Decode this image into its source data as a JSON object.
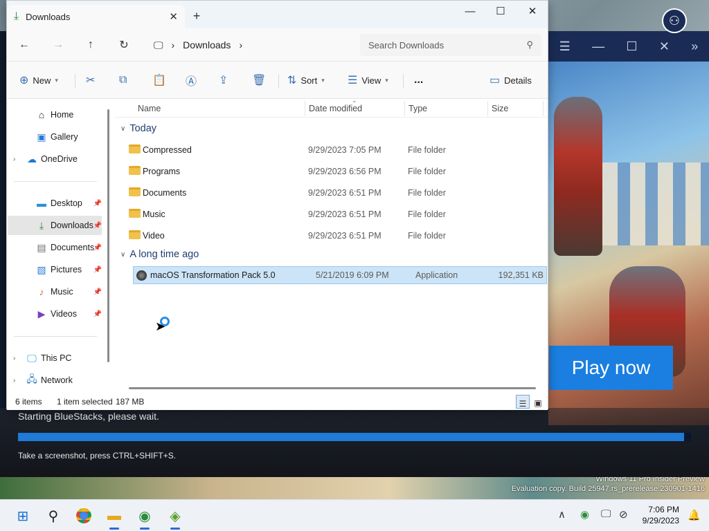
{
  "explorer": {
    "tab_title": "Downloads",
    "address": {
      "segment": "Downloads"
    },
    "search_placeholder": "Search Downloads",
    "toolbar": {
      "new_label": "New",
      "sort_label": "Sort",
      "view_label": "View",
      "more_label": "...",
      "details_label": "Details"
    },
    "sidebar": {
      "items": [
        {
          "label": "Home",
          "icon": "home-icon",
          "expandable": false,
          "pinned": false
        },
        {
          "label": "Gallery",
          "icon": "gallery-icon",
          "expandable": false,
          "pinned": false
        },
        {
          "label": "OneDrive",
          "icon": "cloud-icon",
          "expandable": true,
          "pinned": false
        },
        {
          "label": "Desktop",
          "icon": "desktop-icon",
          "expandable": false,
          "pinned": true
        },
        {
          "label": "Downloads",
          "icon": "download-icon",
          "expandable": false,
          "pinned": true,
          "selected": true
        },
        {
          "label": "Documents",
          "icon": "document-icon",
          "expandable": false,
          "pinned": true
        },
        {
          "label": "Pictures",
          "icon": "picture-icon",
          "expandable": false,
          "pinned": true
        },
        {
          "label": "Music",
          "icon": "music-icon",
          "expandable": false,
          "pinned": true
        },
        {
          "label": "Videos",
          "icon": "video-icon",
          "expandable": false,
          "pinned": true
        },
        {
          "label": "This PC",
          "icon": "monitor-icon",
          "expandable": true,
          "pinned": false
        },
        {
          "label": "Network",
          "icon": "network-icon",
          "expandable": true,
          "pinned": false
        }
      ]
    },
    "columns": {
      "name": "Name",
      "date": "Date modified",
      "type": "Type",
      "size": "Size"
    },
    "groups": [
      {
        "label": "Today",
        "files": [
          {
            "name": "Compressed",
            "date": "9/29/2023 7:05 PM",
            "type": "File folder",
            "size": "",
            "icon": "folder-icon"
          },
          {
            "name": "Programs",
            "date": "9/29/2023 6:56 PM",
            "type": "File folder",
            "size": "",
            "icon": "folder-icon"
          },
          {
            "name": "Documents",
            "date": "9/29/2023 6:51 PM",
            "type": "File folder",
            "size": "",
            "icon": "folder-icon"
          },
          {
            "name": "Music",
            "date": "9/29/2023 6:51 PM",
            "type": "File folder",
            "size": "",
            "icon": "folder-icon"
          },
          {
            "name": "Video",
            "date": "9/29/2023 6:51 PM",
            "type": "File folder",
            "size": "",
            "icon": "folder-icon"
          }
        ]
      },
      {
        "label": "A long time ago",
        "files": [
          {
            "name": "macOS Transformation Pack 5.0",
            "date": "5/21/2019 6:09 PM",
            "type": "Application",
            "size": "192,351 KB",
            "icon": "app-icon",
            "selected": true
          }
        ]
      }
    ],
    "status": {
      "items": "6 items",
      "selection": "1 item selected",
      "size": "187 MB"
    }
  },
  "bluestacks": {
    "play_now": "Play now",
    "status": "Starting BlueStacks, please wait.",
    "progress": 0.99,
    "hint": "Take a screenshot, press CTRL+SHIFT+S."
  },
  "watermark": {
    "line1": "Windows 11 Pro Insider Preview",
    "line2": "Evaluation copy. Build 25947.rs_prerelease.230901-1416"
  },
  "taskbar": {
    "time": "7:06 PM",
    "date": "9/29/2023"
  }
}
